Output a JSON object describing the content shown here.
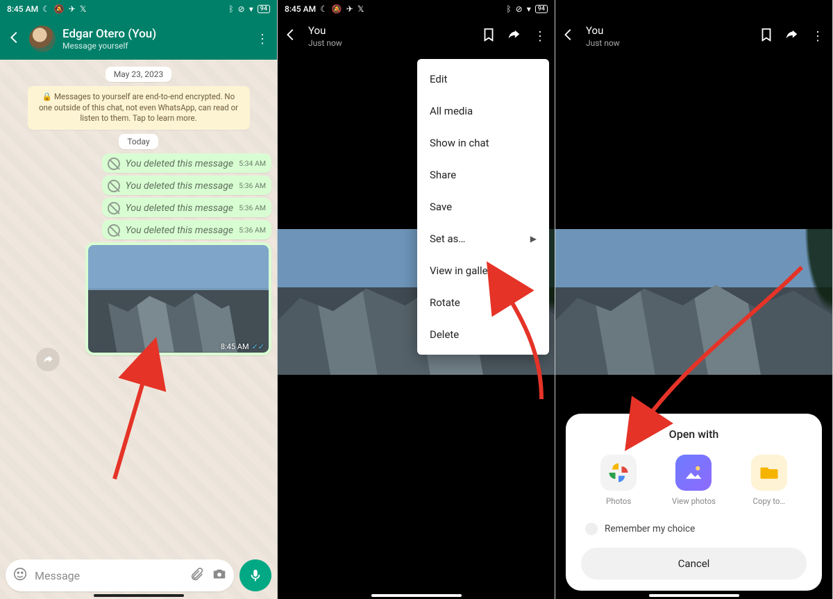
{
  "statusbar": {
    "time": "8:45 AM",
    "battery": "94"
  },
  "screen1": {
    "header": {
      "title": "Edgar Otero (You)",
      "subtitle": "Message yourself"
    },
    "date_pill": "May 23, 2023",
    "encryption_note": "🔒 Messages to yourself are end-to-end encrypted. No one outside of this chat, not even WhatsApp, can read or listen to them. Tap to learn more.",
    "today_pill": "Today",
    "deleted_messages": [
      {
        "text": "You deleted this message",
        "time": "5:34 AM"
      },
      {
        "text": "You deleted this message",
        "time": "5:36 AM"
      },
      {
        "text": "You deleted this message",
        "time": "5:36 AM"
      },
      {
        "text": "You deleted this message",
        "time": "5:36 AM"
      }
    ],
    "image_time": "8:45 AM",
    "input_placeholder": "Message"
  },
  "viewer": {
    "title": "You",
    "subtitle": "Just now"
  },
  "context_menu": {
    "items": [
      "Edit",
      "All media",
      "Show in chat",
      "Share",
      "Save",
      "Set as…",
      "View in gallery",
      "Rotate",
      "Delete"
    ],
    "submenu_index": 5
  },
  "sheet": {
    "title": "Open with",
    "apps": [
      {
        "label": "Photos"
      },
      {
        "label": "View photos"
      },
      {
        "label": "Copy to…"
      }
    ],
    "remember_label": "Remember my choice",
    "cancel_label": "Cancel"
  }
}
